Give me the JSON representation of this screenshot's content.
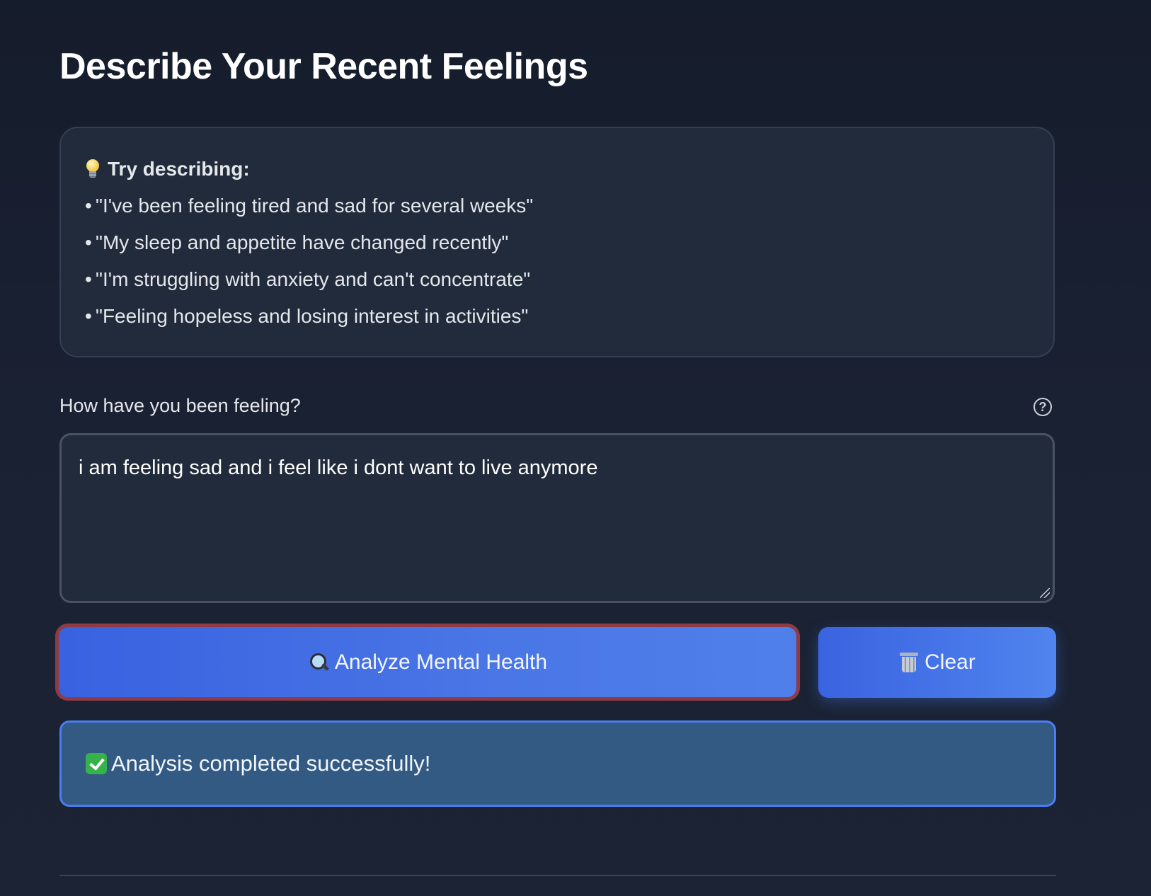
{
  "page": {
    "title": "Describe Your Recent Feelings"
  },
  "tips": {
    "heading": "Try describing:",
    "heading_icon": "lightbulb-icon",
    "bullet": "•",
    "items": [
      "\"I've been feeling tired and sad for several weeks\"",
      "\"My sleep and appetite have changed recently\"",
      "\"I'm struggling with anxiety and can't concentrate\"",
      "\"Feeling hopeless and losing interest in activities\""
    ]
  },
  "feeling_field": {
    "label": "How have you been feeling?",
    "help_icon": "?",
    "value": "i am feeling sad and i feel like i dont want to live anymore"
  },
  "actions": {
    "analyze_label": "Analyze Mental Health",
    "analyze_icon": "magnifier-icon",
    "clear_label": "Clear",
    "clear_icon": "trash-icon"
  },
  "status": {
    "message": "Analysis completed successfully!",
    "icon": "check-mark-icon"
  },
  "colors": {
    "background": "#172033",
    "card": "#212b3c",
    "primary_button": "#3862e0",
    "focus_ring": "#8e3b46",
    "status_bg": "#335a83",
    "status_border": "#4a7ef0"
  }
}
